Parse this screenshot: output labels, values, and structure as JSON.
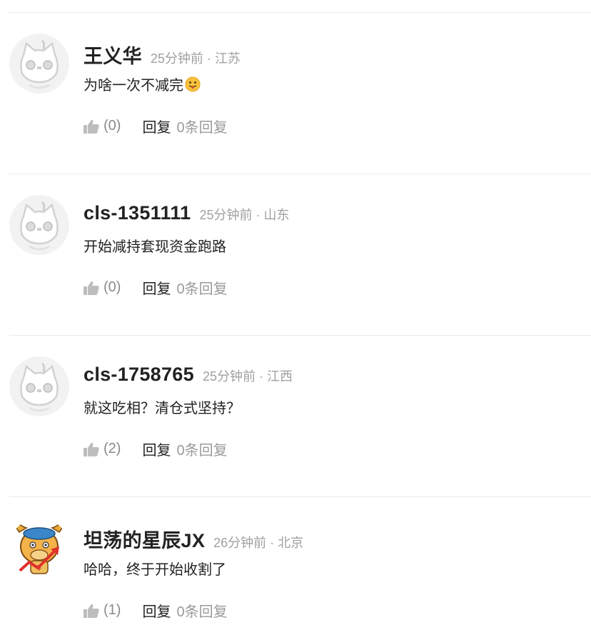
{
  "comments": [
    {
      "username": "王义华",
      "time": "25分钟前",
      "location": "江苏",
      "text": "为啥一次不减完",
      "emoji": "tongue-out-emoji",
      "likes": "(0)",
      "reply_label": "回复",
      "reply_count": "0条回复",
      "avatar": "default-cat-avatar"
    },
    {
      "username": "cls-1351111",
      "time": "25分钟前",
      "location": "山东",
      "text": "开始减持套现资金跑路",
      "likes": "(0)",
      "reply_label": "回复",
      "reply_count": "0条回复",
      "avatar": "default-cat-avatar"
    },
    {
      "username": "cls-1758765",
      "time": "25分钟前",
      "location": "江西",
      "text": "就这吃相？清仓式坚持？",
      "likes": "(2)",
      "reply_label": "回复",
      "reply_count": "0条回复",
      "avatar": "default-cat-avatar"
    },
    {
      "username": "坦荡的星辰JX",
      "time": "26分钟前",
      "location": "北京",
      "text": "哈哈，终于开始收割了",
      "likes": "(1)",
      "reply_label": "回复",
      "reply_count": "0条回复",
      "avatar": "bull-cartoon-avatar"
    }
  ],
  "separator": "·",
  "colors": {
    "meta_gray": "#a0a0a0",
    "like_gray": "#8a8a8a",
    "divider": "#ebebeb",
    "text_dark": "#222222"
  }
}
